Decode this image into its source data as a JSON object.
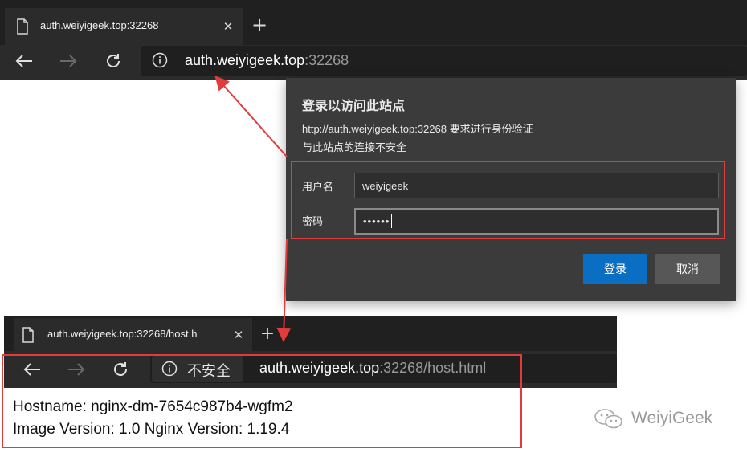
{
  "top_browser": {
    "tab_title": "auth.weiyigeek.top:32268",
    "new_tab_symbol": "+",
    "close_symbol": "✕",
    "url_host": "auth.weiyigeek.top",
    "url_port": ":32268"
  },
  "auth_dialog": {
    "title": "登录以访问此站点",
    "message_line1": "http://auth.weiyigeek.top:32268 要求进行身份验证",
    "message_line2": "与此站点的连接不安全",
    "username_label": "用户名",
    "username_value": "weiyigeek",
    "password_label": "密码",
    "password_value": "••••••",
    "login_button": "登录",
    "cancel_button": "取消"
  },
  "bottom_browser": {
    "tab_title": "auth.weiyigeek.top:32268/host.h",
    "new_tab_symbol": "+",
    "close_symbol": "✕",
    "security_text": "不安全",
    "url_host": "auth.weiyigeek.top",
    "url_rest": ":32268/host.html"
  },
  "page": {
    "hostname_line": "Hostname: nginx-dm-7654c987b4-wgfm2",
    "image_version_label": "Image Version: ",
    "image_version_value": "1.0 ",
    "nginx_version_text": "Nginx Version: 1.19.4"
  },
  "watermark": {
    "text": "WeiyiGeek"
  },
  "colors": {
    "accent_blue": "#0a6fc2",
    "annotation_red": "#e23b3b",
    "dialog_bg": "#3b3b3b",
    "chrome_dark": "#2b2b2b"
  }
}
